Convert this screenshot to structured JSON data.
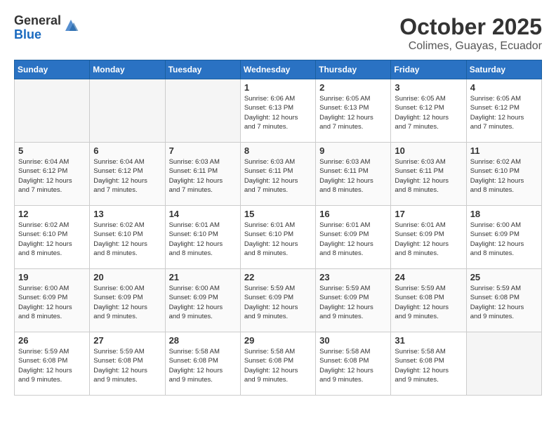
{
  "header": {
    "logo_line1": "General",
    "logo_line2": "Blue",
    "month": "October 2025",
    "location": "Colimes, Guayas, Ecuador"
  },
  "days_of_week": [
    "Sunday",
    "Monday",
    "Tuesday",
    "Wednesday",
    "Thursday",
    "Friday",
    "Saturday"
  ],
  "weeks": [
    [
      {
        "day": "",
        "info": ""
      },
      {
        "day": "",
        "info": ""
      },
      {
        "day": "",
        "info": ""
      },
      {
        "day": "1",
        "info": "Sunrise: 6:06 AM\nSunset: 6:13 PM\nDaylight: 12 hours\nand 7 minutes."
      },
      {
        "day": "2",
        "info": "Sunrise: 6:05 AM\nSunset: 6:13 PM\nDaylight: 12 hours\nand 7 minutes."
      },
      {
        "day": "3",
        "info": "Sunrise: 6:05 AM\nSunset: 6:12 PM\nDaylight: 12 hours\nand 7 minutes."
      },
      {
        "day": "4",
        "info": "Sunrise: 6:05 AM\nSunset: 6:12 PM\nDaylight: 12 hours\nand 7 minutes."
      }
    ],
    [
      {
        "day": "5",
        "info": "Sunrise: 6:04 AM\nSunset: 6:12 PM\nDaylight: 12 hours\nand 7 minutes."
      },
      {
        "day": "6",
        "info": "Sunrise: 6:04 AM\nSunset: 6:12 PM\nDaylight: 12 hours\nand 7 minutes."
      },
      {
        "day": "7",
        "info": "Sunrise: 6:03 AM\nSunset: 6:11 PM\nDaylight: 12 hours\nand 7 minutes."
      },
      {
        "day": "8",
        "info": "Sunrise: 6:03 AM\nSunset: 6:11 PM\nDaylight: 12 hours\nand 7 minutes."
      },
      {
        "day": "9",
        "info": "Sunrise: 6:03 AM\nSunset: 6:11 PM\nDaylight: 12 hours\nand 8 minutes."
      },
      {
        "day": "10",
        "info": "Sunrise: 6:03 AM\nSunset: 6:11 PM\nDaylight: 12 hours\nand 8 minutes."
      },
      {
        "day": "11",
        "info": "Sunrise: 6:02 AM\nSunset: 6:10 PM\nDaylight: 12 hours\nand 8 minutes."
      }
    ],
    [
      {
        "day": "12",
        "info": "Sunrise: 6:02 AM\nSunset: 6:10 PM\nDaylight: 12 hours\nand 8 minutes."
      },
      {
        "day": "13",
        "info": "Sunrise: 6:02 AM\nSunset: 6:10 PM\nDaylight: 12 hours\nand 8 minutes."
      },
      {
        "day": "14",
        "info": "Sunrise: 6:01 AM\nSunset: 6:10 PM\nDaylight: 12 hours\nand 8 minutes."
      },
      {
        "day": "15",
        "info": "Sunrise: 6:01 AM\nSunset: 6:10 PM\nDaylight: 12 hours\nand 8 minutes."
      },
      {
        "day": "16",
        "info": "Sunrise: 6:01 AM\nSunset: 6:09 PM\nDaylight: 12 hours\nand 8 minutes."
      },
      {
        "day": "17",
        "info": "Sunrise: 6:01 AM\nSunset: 6:09 PM\nDaylight: 12 hours\nand 8 minutes."
      },
      {
        "day": "18",
        "info": "Sunrise: 6:00 AM\nSunset: 6:09 PM\nDaylight: 12 hours\nand 8 minutes."
      }
    ],
    [
      {
        "day": "19",
        "info": "Sunrise: 6:00 AM\nSunset: 6:09 PM\nDaylight: 12 hours\nand 8 minutes."
      },
      {
        "day": "20",
        "info": "Sunrise: 6:00 AM\nSunset: 6:09 PM\nDaylight: 12 hours\nand 9 minutes."
      },
      {
        "day": "21",
        "info": "Sunrise: 6:00 AM\nSunset: 6:09 PM\nDaylight: 12 hours\nand 9 minutes."
      },
      {
        "day": "22",
        "info": "Sunrise: 5:59 AM\nSunset: 6:09 PM\nDaylight: 12 hours\nand 9 minutes."
      },
      {
        "day": "23",
        "info": "Sunrise: 5:59 AM\nSunset: 6:09 PM\nDaylight: 12 hours\nand 9 minutes."
      },
      {
        "day": "24",
        "info": "Sunrise: 5:59 AM\nSunset: 6:08 PM\nDaylight: 12 hours\nand 9 minutes."
      },
      {
        "day": "25",
        "info": "Sunrise: 5:59 AM\nSunset: 6:08 PM\nDaylight: 12 hours\nand 9 minutes."
      }
    ],
    [
      {
        "day": "26",
        "info": "Sunrise: 5:59 AM\nSunset: 6:08 PM\nDaylight: 12 hours\nand 9 minutes."
      },
      {
        "day": "27",
        "info": "Sunrise: 5:59 AM\nSunset: 6:08 PM\nDaylight: 12 hours\nand 9 minutes."
      },
      {
        "day": "28",
        "info": "Sunrise: 5:58 AM\nSunset: 6:08 PM\nDaylight: 12 hours\nand 9 minutes."
      },
      {
        "day": "29",
        "info": "Sunrise: 5:58 AM\nSunset: 6:08 PM\nDaylight: 12 hours\nand 9 minutes."
      },
      {
        "day": "30",
        "info": "Sunrise: 5:58 AM\nSunset: 6:08 PM\nDaylight: 12 hours\nand 9 minutes."
      },
      {
        "day": "31",
        "info": "Sunrise: 5:58 AM\nSunset: 6:08 PM\nDaylight: 12 hours\nand 9 minutes."
      },
      {
        "day": "",
        "info": ""
      }
    ]
  ]
}
